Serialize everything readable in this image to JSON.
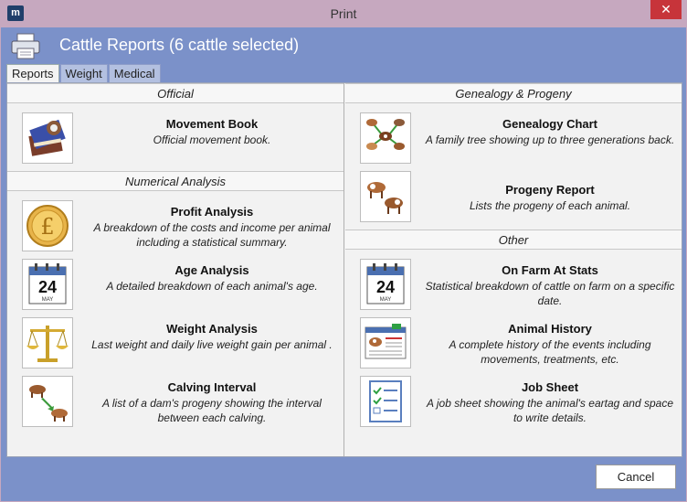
{
  "window": {
    "title": "Print",
    "app_icon_glyph": "m",
    "close_glyph": "✕"
  },
  "header": {
    "title": "Cattle Reports (6 cattle selected)",
    "icon": "printer-icon"
  },
  "tabs": [
    {
      "label": "Reports",
      "active": true
    },
    {
      "label": "Weight",
      "active": false
    },
    {
      "label": "Medical",
      "active": false
    }
  ],
  "left": {
    "official": {
      "header": "Official",
      "items": [
        {
          "title": "Movement Book",
          "desc": "Official movement book.",
          "icon": "movement-book-icon"
        }
      ]
    },
    "numerical": {
      "header": "Numerical Analysis",
      "items": [
        {
          "title": "Profit Analysis",
          "desc": "A breakdown of the costs and income per animal including a statistical summary.",
          "icon": "pound-coin-icon"
        },
        {
          "title": "Age Analysis",
          "desc": "A detailed breakdown of each animal's age.",
          "icon": "calendar-icon"
        },
        {
          "title": "Weight Analysis",
          "desc": "Last weight and daily live weight gain per animal .",
          "icon": "scales-icon"
        },
        {
          "title": "Calving Interval",
          "desc": "A list of a dam's progeny showing the interval between each calving.",
          "icon": "calving-interval-icon"
        }
      ]
    }
  },
  "right": {
    "genealogy": {
      "header": "Genealogy & Progeny",
      "items": [
        {
          "title": "Genealogy Chart",
          "desc": "A family tree showing up to three generations back.",
          "icon": "family-tree-icon"
        },
        {
          "title": "Progeny Report",
          "desc": "Lists the progeny of each animal.",
          "icon": "progeny-icon"
        }
      ]
    },
    "other": {
      "header": "Other",
      "items": [
        {
          "title": "On Farm At Stats",
          "desc": "Statistical breakdown of cattle on farm on a specific date.",
          "icon": "calendar-icon"
        },
        {
          "title": "Animal History",
          "desc": "A complete history of the events including movements, treatments, etc.",
          "icon": "animal-history-icon"
        },
        {
          "title": "Job Sheet",
          "desc": "A job sheet showing the animal's eartag and space to write details.",
          "icon": "job-sheet-icon"
        }
      ]
    }
  },
  "calendar_icon": {
    "day": "24",
    "month": "MAY"
  },
  "footer": {
    "cancel_label": "Cancel"
  },
  "colors": {
    "frame": "#7b91c9",
    "titlebar": "#c6a8bf",
    "close": "#c7343a",
    "panel": "#f2f2f2"
  }
}
